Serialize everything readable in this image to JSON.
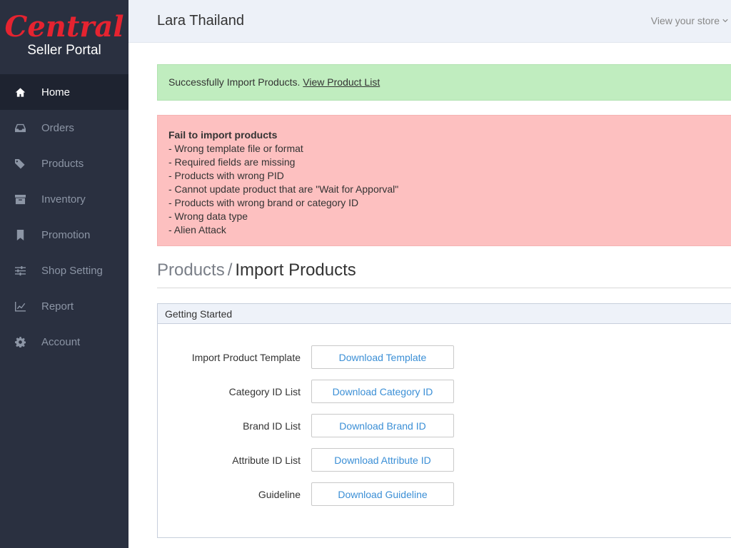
{
  "brand": {
    "logo_text": "Central",
    "subtitle": "Seller Portal"
  },
  "sidebar": {
    "items": [
      {
        "label": "Home",
        "icon": "home-icon",
        "active": true
      },
      {
        "label": "Orders",
        "icon": "inbox-icon"
      },
      {
        "label": "Products",
        "icon": "tag-icon"
      },
      {
        "label": "Inventory",
        "icon": "archive-icon"
      },
      {
        "label": "Promotion",
        "icon": "bookmark-icon"
      },
      {
        "label": "Shop Setting",
        "icon": "sliders-icon"
      },
      {
        "label": "Report",
        "icon": "line-chart-icon"
      },
      {
        "label": "Account",
        "icon": "gear-icon"
      }
    ]
  },
  "header": {
    "store_name": "Lara Thailand",
    "view_store": "View your store"
  },
  "alerts": {
    "success": {
      "text": "Successfully Import Products. ",
      "link": "View Product List"
    },
    "error": {
      "title": "Fail to import products",
      "lines": [
        "- Wrong template file or format",
        "- Required fields are missing",
        "- Products with wrong PID",
        "- Cannot update product that are \"Wait for Apporval\"",
        "- Products with wrong brand or category ID",
        "- Wrong data type",
        "- Alien Attack"
      ]
    }
  },
  "breadcrumb": {
    "parent": "Products",
    "separator": "/",
    "current": "Import Products"
  },
  "panel": {
    "title": "Getting Started",
    "rows": [
      {
        "label": "Import Product Template",
        "button": "Download Template"
      },
      {
        "label": "Category ID List",
        "button": "Download Category ID"
      },
      {
        "label": "Brand ID List",
        "button": "Download Brand ID"
      },
      {
        "label": "Attribute ID List",
        "button": "Download Attribute ID"
      },
      {
        "label": "Guideline",
        "button": "Download Guideline"
      }
    ]
  },
  "colors": {
    "sidebar_bg": "#2a3040",
    "brand_red": "#e52330",
    "link_blue": "#3b8fd6",
    "success_bg": "#c0edbf",
    "error_bg": "#fdc0c0"
  }
}
